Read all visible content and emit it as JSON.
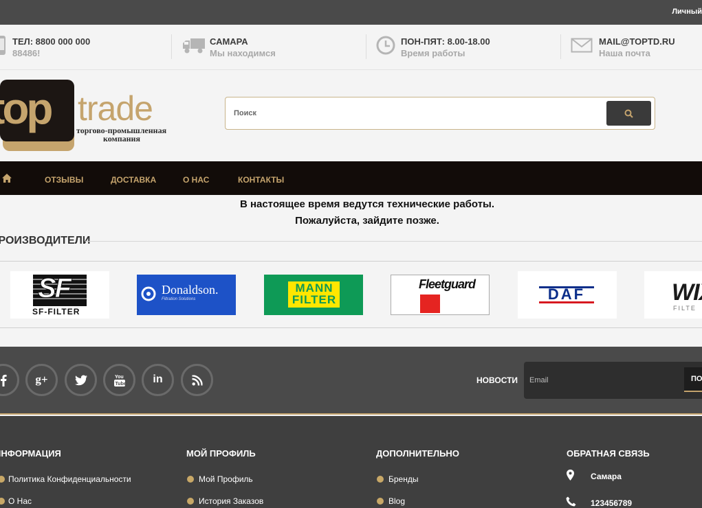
{
  "topbar": {
    "account_label": "Личный"
  },
  "info": [
    {
      "line1": "ТЕЛ: 8800 000 000",
      "line2": "88486!",
      "icon": "phone-icon"
    },
    {
      "line1": "САМАРА",
      "line2": "Мы находимся",
      "icon": "truck-icon"
    },
    {
      "line1": "ПОН-ПЯТ: 8.00-18.00",
      "line2": "Время работы",
      "icon": "clock-icon"
    },
    {
      "line1": "MAIL@TOPTD.RU",
      "line2": "Наша почта",
      "icon": "envelope-icon"
    }
  ],
  "logo": {
    "text_top": "top",
    "text_trade": "trade",
    "tagline1": "торгово-промышленная",
    "tagline2": "компания"
  },
  "search": {
    "placeholder": "Поиск",
    "button_icon": "search-icon"
  },
  "nav": {
    "home_icon": "home-icon",
    "items": [
      "ОТЗЫВЫ",
      "ДОСТАВКА",
      "О НАС",
      "КОНТАКТЫ"
    ]
  },
  "maintenance": {
    "line1": "В настоящее время ведутся технические работы.",
    "line2": "Пожалуйста, зайдите позже."
  },
  "manufacturers": {
    "title": "ПРОИЗВОДИТЕЛИ",
    "brands": [
      {
        "name": "SF-FILTER",
        "logo_text": "SF",
        "caption": "SF-FILTER"
      },
      {
        "name": "Donaldson",
        "logo_text": "Donaldson.",
        "caption": "Filtration Solutions"
      },
      {
        "name": "MANN FILTER",
        "logo_text": "MANN",
        "caption": "FILTER"
      },
      {
        "name": "Fleetguard",
        "logo_text": "Fleetguard"
      },
      {
        "name": "DAF",
        "logo_text": "DAF"
      },
      {
        "name": "WIX",
        "logo_text": "WIX",
        "caption": "FILTE"
      }
    ]
  },
  "social": [
    "facebook-icon",
    "google-plus-icon",
    "twitter-icon",
    "youtube-icon",
    "linkedin-icon",
    "rss-icon"
  ],
  "newsletter": {
    "label": "НОВОСТИ",
    "placeholder": "Email",
    "button": "ПОД"
  },
  "footer": {
    "col1": {
      "title": "ИНФОРМАЦИЯ",
      "links": [
        "Политика Конфиденциальности",
        "О Нас"
      ]
    },
    "col2": {
      "title": "МОЙ ПРОФИЛЬ",
      "links": [
        "Мой Профиль",
        "История Заказов"
      ]
    },
    "col3": {
      "title": "ДОПОЛНИТЕЛЬНО",
      "links": [
        "Бренды",
        "Blog"
      ]
    },
    "col4": {
      "title": "ОБРАТНАЯ СВЯЗЬ",
      "city": "Самара",
      "phone": "123456789"
    }
  },
  "colors": {
    "gold": "#c5a46d",
    "nav_bg": "#120c09",
    "footer_bg": "#4a4a4a"
  }
}
